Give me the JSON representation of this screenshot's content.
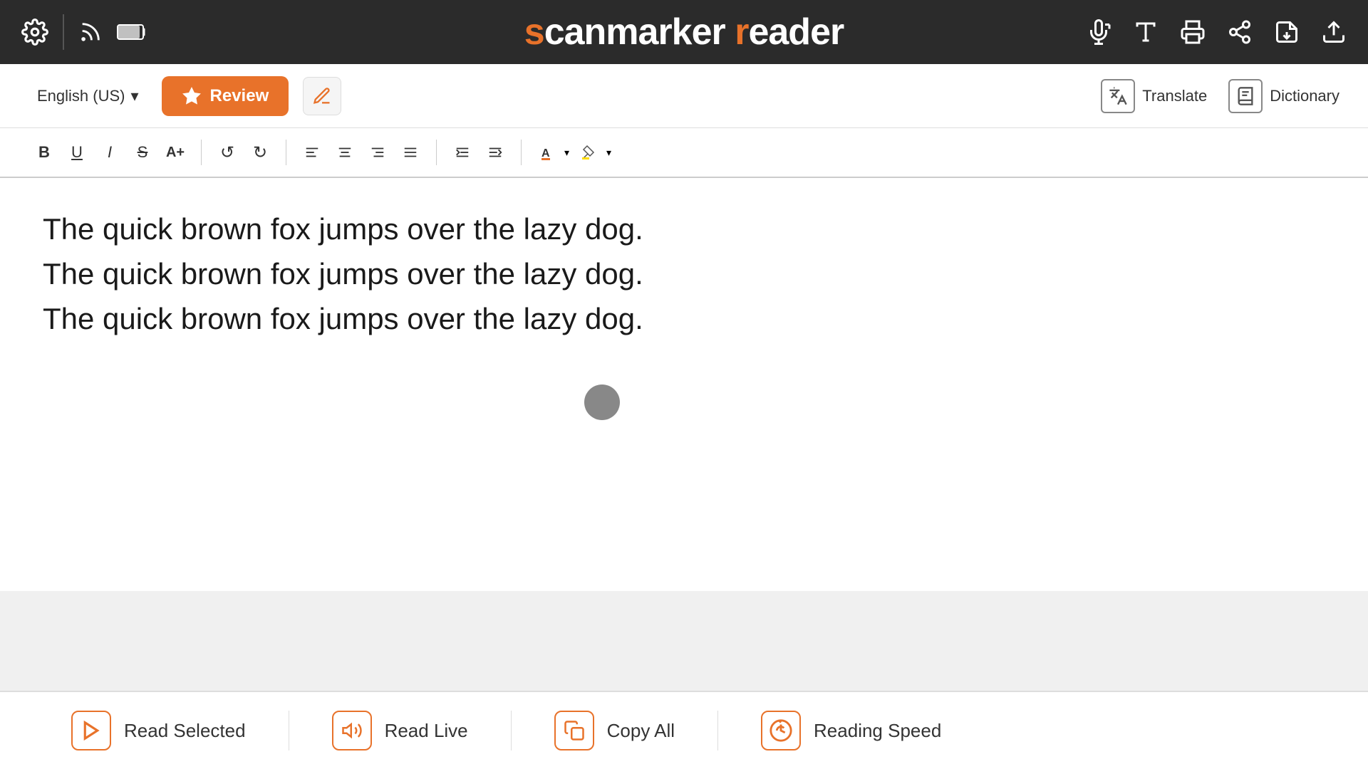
{
  "app": {
    "title_prefix": "scanmarker ",
    "title_suffix": "reader",
    "title_s_colored": "s",
    "title_r_colored": "r"
  },
  "top_nav": {
    "settings_icon": "gear-icon",
    "rss_icon": "rss-icon",
    "battery_icon": "battery-icon",
    "mic_icon": "mic-icon",
    "font_icon": "font-icon",
    "print_icon": "print-icon",
    "share_icon": "share-icon",
    "import_icon": "import-icon",
    "export_icon": "export-icon"
  },
  "toolbar2": {
    "language": "English (US)",
    "review_label": "Review",
    "translate_label": "Translate",
    "dictionary_label": "Dictionary"
  },
  "format_bar": {
    "bold": "B",
    "underline": "U",
    "italic": "I",
    "strikethrough": "S",
    "text_size": "A+",
    "undo": "↶",
    "redo": "↷",
    "align_left": "≡",
    "align_center": "≡",
    "align_right": "≡",
    "align_justify": "≡",
    "indent_decrease": "⇐",
    "indent_increase": "⇒",
    "font_color": "A",
    "highlight_color": "H"
  },
  "editor": {
    "content_line1": "The quick brown fox jumps over the lazy dog.",
    "content_line2": "The quick brown fox jumps over the lazy dog.",
    "content_line3": "The quick brown fox jumps over the lazy dog."
  },
  "bottom_bar": {
    "read_selected_label": "Read Selected",
    "read_live_label": "Read Live",
    "copy_all_label": "Copy All",
    "reading_speed_label": "Reading Speed"
  }
}
